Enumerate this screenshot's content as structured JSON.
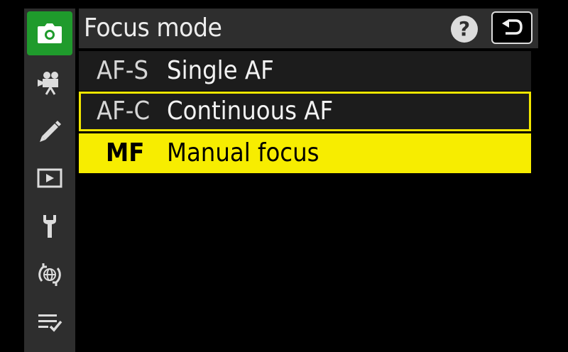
{
  "header": {
    "title": "Focus mode",
    "help_label": "?"
  },
  "sidebar": {
    "items": [
      {
        "icon": "camera-icon",
        "active": true
      },
      {
        "icon": "movie-camera-icon",
        "active": false
      },
      {
        "icon": "pencil-icon",
        "active": false
      },
      {
        "icon": "playback-icon",
        "active": false
      },
      {
        "icon": "wrench-icon",
        "active": false
      },
      {
        "icon": "network-icon",
        "active": false
      },
      {
        "icon": "my-menu-icon",
        "active": false
      }
    ]
  },
  "options": [
    {
      "code": "AF-S",
      "label": "Single AF",
      "state": "normal"
    },
    {
      "code": "AF-C",
      "label": "Continuous AF",
      "state": "current"
    },
    {
      "code": "MF",
      "label": "Manual focus",
      "state": "highlighted"
    }
  ],
  "colors": {
    "accent_green": "#1f9b2c",
    "highlight_yellow": "#f7ed00",
    "panel_gray": "#2e2e2e"
  }
}
